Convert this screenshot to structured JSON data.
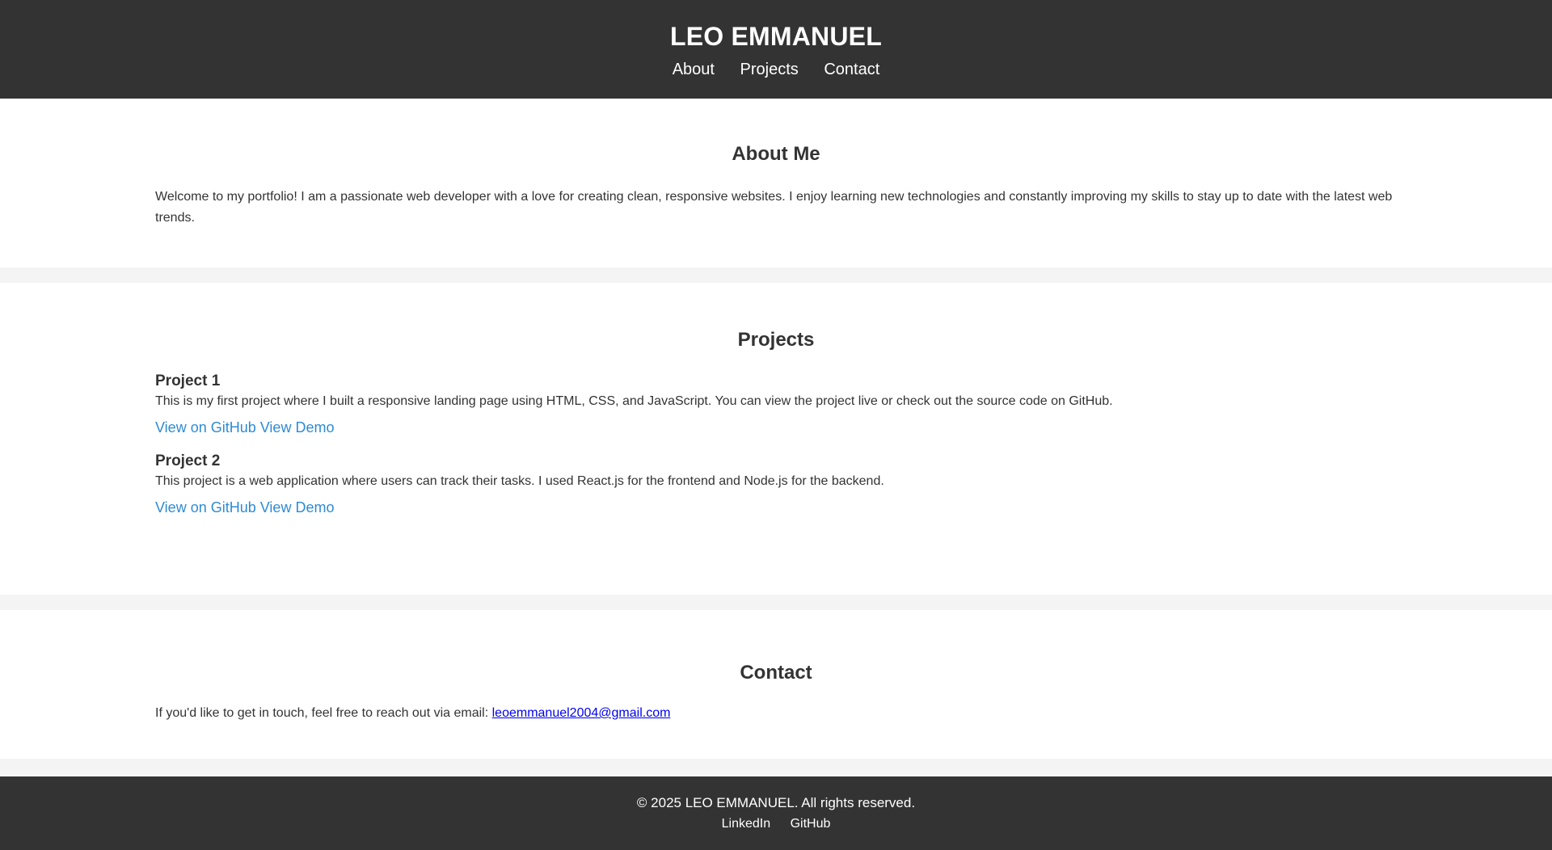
{
  "header": {
    "title": "LEO EMMANUEL",
    "nav": [
      "About",
      "Projects",
      "Contact"
    ]
  },
  "about": {
    "heading": "About Me",
    "text": "Welcome to my portfolio! I am a passionate web developer with a love for creating clean, responsive websites. I enjoy learning new technologies and constantly improving my skills to stay up to date with the latest web trends."
  },
  "projects": {
    "heading": "Projects",
    "items": [
      {
        "title": "Project 1",
        "description": "This is my first project where I built a responsive landing page using HTML, CSS, and JavaScript. You can view the project live or check out the source code on GitHub.",
        "github_label": "View on GitHub",
        "demo_label": "View Demo"
      },
      {
        "title": "Project 2",
        "description": "This project is a web application where users can track their tasks. I used React.js for the frontend and Node.js for the backend.",
        "github_label": "View on GitHub",
        "demo_label": "View Demo"
      }
    ]
  },
  "contact": {
    "heading": "Contact",
    "text": "If you'd like to get in touch, feel free to reach out via email:",
    "email": "leoemmanuel2004@gmail.com"
  },
  "footer": {
    "copyright": "© 2025 LEO EMMANUEL. All rights reserved.",
    "links": [
      "LinkedIn",
      "GitHub"
    ]
  },
  "colors": {
    "header_bg": "#333333",
    "page_bg": "#f4f4f4",
    "link_blue": "#2e8bd6",
    "email_link": "#0000ee"
  }
}
